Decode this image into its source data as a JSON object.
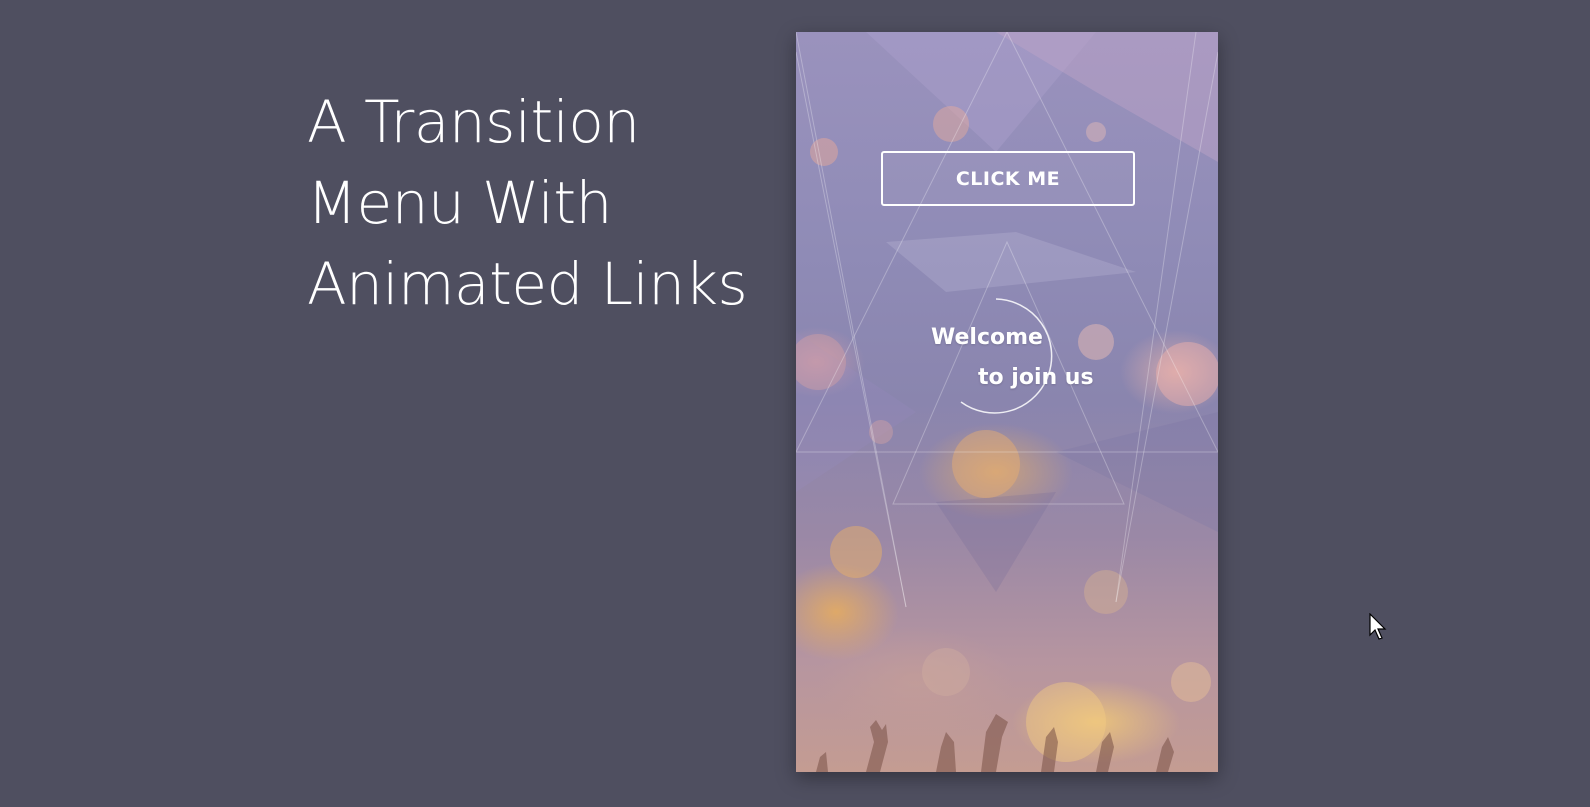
{
  "headline": {
    "line1": "A Transition",
    "line2": "Menu With",
    "line3": "Animated Links"
  },
  "phone": {
    "button_label": "CLICK ME",
    "welcome_line1": "Welcome",
    "welcome_line2": "to  join us"
  },
  "colors": {
    "page_background": "#4f4f60",
    "text": "#ffffff"
  },
  "icons": {
    "cursor": "mouse-pointer-icon"
  }
}
